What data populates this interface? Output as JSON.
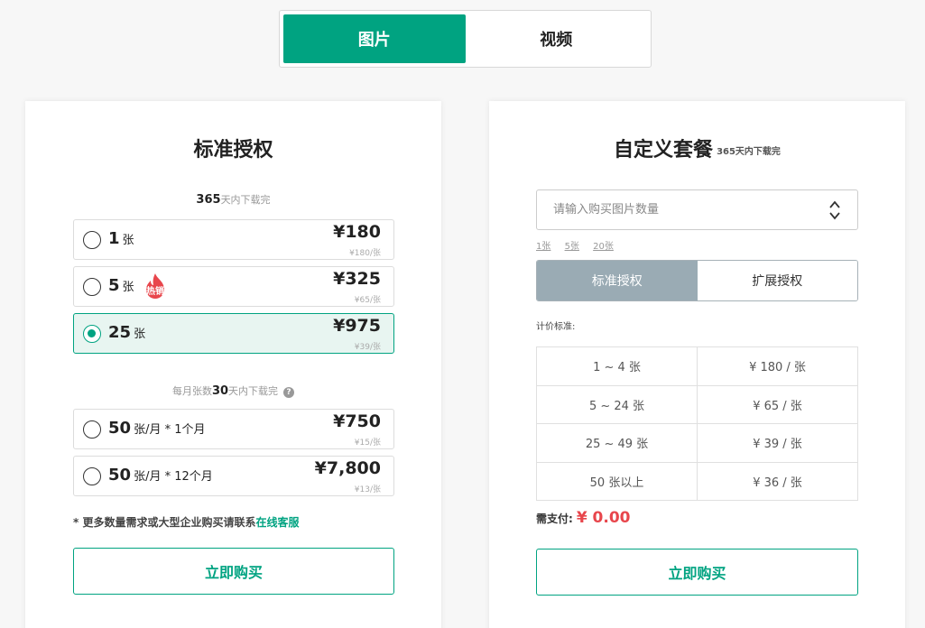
{
  "top_tabs": [
    {
      "label": "图片",
      "active": true
    },
    {
      "label": "视频",
      "active": false
    }
  ],
  "left": {
    "title": "标准授权",
    "section1_note": {
      "count": "365",
      "text": "天内下载完"
    },
    "options": [
      {
        "qty": "1",
        "unit": "张",
        "price": "¥180",
        "unit_price": "¥180/张",
        "selected": false,
        "hot": false
      },
      {
        "qty": "5",
        "unit": "张",
        "price": "¥325",
        "unit_price": "¥65/张",
        "selected": false,
        "hot": true
      },
      {
        "qty": "25",
        "unit": "张",
        "price": "¥975",
        "unit_price": "¥39/张",
        "selected": true,
        "hot": false
      }
    ],
    "hot_label": "热销",
    "section2_note": {
      "prefix": "每月张数",
      "count": "30",
      "text": "天内下载完",
      "help": "?"
    },
    "monthly_options": [
      {
        "qty": "50",
        "unit": "张/月 * 1个月",
        "price": "¥750",
        "unit_price": "¥15/张"
      },
      {
        "qty": "50",
        "unit": "张/月 * 12个月",
        "price": "¥7,800",
        "unit_price": "¥13/张"
      }
    ],
    "more_note": "* 更多数量需求或大型企业购买请联系",
    "more_link": "在线客服",
    "buy_label": "立即购买"
  },
  "right": {
    "title": "自定义套餐",
    "title_sub": "365天内下载完",
    "input_placeholder": "请输入购买图片数量",
    "quick_links": [
      "1张",
      "5张",
      "20张"
    ],
    "license_tabs": [
      {
        "label": "标准授权",
        "active": true
      },
      {
        "label": "扩展授权",
        "active": false
      }
    ],
    "pricing_label": "计价标准:",
    "pricing_rows": [
      [
        "1 ~ 4 张",
        "¥ 180 / 张"
      ],
      [
        "5 ~ 24 张",
        "¥ 65 / 张"
      ],
      [
        "25 ~ 49 张",
        "¥ 39 / 张"
      ],
      [
        "50 张以上",
        "¥ 36 / 张"
      ]
    ],
    "total_label": "需支付:",
    "total_amount": "¥ 0.00",
    "buy_label": "立即购买"
  },
  "colors": {
    "accent": "#00a381",
    "hot": "#e8464c",
    "tab_active_gray": "#9aabb4"
  }
}
